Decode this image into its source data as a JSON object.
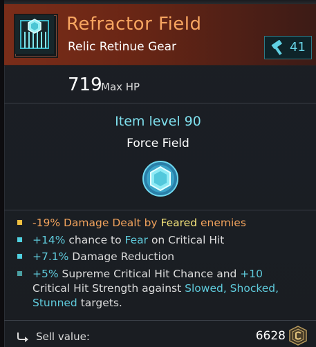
{
  "item": {
    "name": "Refractor Field",
    "subtitle": "Relic Retinue Gear",
    "repair_count": "41"
  },
  "stats": {
    "hp_value": "719",
    "hp_label": "Max HP",
    "item_level": "Item level 90",
    "item_type": "Force Field"
  },
  "modifiers": [
    {
      "bullet_color": "#f0c040",
      "parts": [
        {
          "text": "-19% ",
          "cls": "orange"
        },
        {
          "text": "Damage Dealt by ",
          "cls": "orange"
        },
        {
          "text": "Feared",
          "cls": "yellow"
        },
        {
          "text": " enemies",
          "cls": "orange"
        }
      ]
    },
    {
      "bullet_color": "#4fd0e0",
      "parts": [
        {
          "text": "+14%",
          "cls": "teal"
        },
        {
          "text": " chance to ",
          "cls": ""
        },
        {
          "text": "Fear",
          "cls": "teal"
        },
        {
          "text": " on Critical Hit",
          "cls": ""
        }
      ]
    },
    {
      "bullet_color": "#4fd0e0",
      "parts": [
        {
          "text": "+7.1%",
          "cls": "teal"
        },
        {
          "text": " Damage Reduction",
          "cls": ""
        }
      ]
    },
    {
      "bullet_color": "#4aa0a4",
      "parts": [
        {
          "text": "+5%",
          "cls": "teal"
        },
        {
          "text": " Supreme Critical Hit Chance and ",
          "cls": ""
        },
        {
          "text": "+10",
          "cls": "teal"
        },
        {
          "text": " Critical Hit Strength against ",
          "cls": ""
        },
        {
          "text": "Slowed, Shocked, Stunned",
          "cls": "teal"
        },
        {
          "text": " targets.",
          "cls": ""
        }
      ]
    }
  ],
  "sell": {
    "label": "Sell value:",
    "value": "6628"
  },
  "colors": {
    "title": "#f7a560",
    "accent_teal": "#5fcbdc",
    "header_bg": "#7a2d19"
  },
  "icons": [
    "force-field-icon",
    "hammer-icon",
    "gem-icon",
    "sell-arrow-icon",
    "currency-coin-icon"
  ]
}
